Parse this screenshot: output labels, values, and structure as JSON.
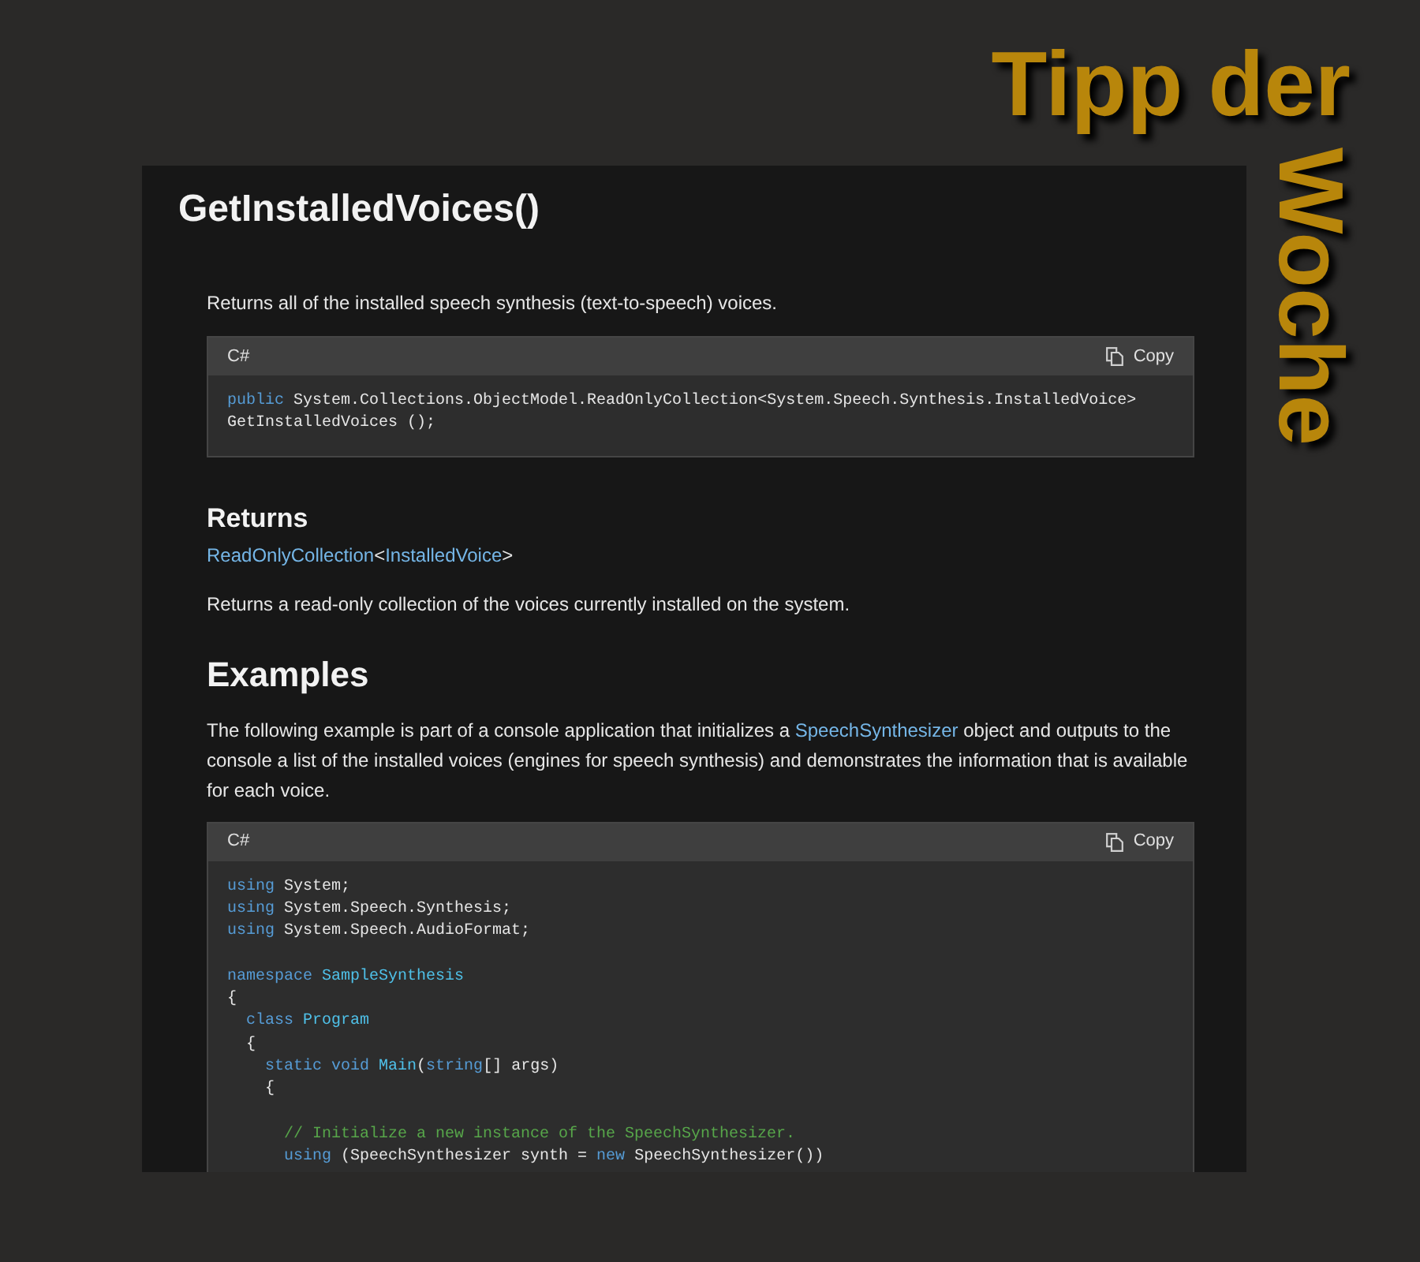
{
  "banner": {
    "line_1": "Tipp der",
    "line_2": "Woche"
  },
  "doc": {
    "title": "GetInstalledVoices()",
    "summary": "Returns all of the installed speech synthesis (text-to-speech) voices.",
    "signature": {
      "language": "C#",
      "copy_label": "Copy",
      "lines": [
        {
          "kind": "code",
          "tokens": [
            {
              "text": "public",
              "kind": "keyword"
            },
            {
              "text": " System.Collections.ObjectModel.ReadOnlyCollection<System.Speech.Synthesis.InstalledVoice>",
              "kind": "plain"
            }
          ]
        },
        {
          "kind": "code",
          "tokens": [
            {
              "text": "GetInstalledVoices ();",
              "kind": "plain"
            }
          ]
        }
      ]
    },
    "returns": {
      "heading": "Returns",
      "type_parts": [
        {
          "text": "ReadOnlyCollection",
          "kind": "link"
        },
        {
          "text": "<",
          "kind": "text"
        },
        {
          "text": "InstalledVoice",
          "kind": "link"
        },
        {
          "text": ">",
          "kind": "text"
        }
      ],
      "description": "Returns a read-only collection of the voices currently installed on the system."
    },
    "examples": {
      "heading": "Examples",
      "paragraph": [
        {
          "text": "The following example is part of a console application that initializes a ",
          "kind": "text"
        },
        {
          "text": "SpeechSynthesizer",
          "kind": "link"
        },
        {
          "text": " object and outputs to the console a list of the installed voices (engines for speech synthesis) and demonstrates the information that is available for each voice.",
          "kind": "text"
        }
      ],
      "code": {
        "language": "C#",
        "copy_label": "Copy",
        "lines": [
          {
            "kind": "code",
            "tokens": [
              {
                "text": "using",
                "kind": "keyword"
              },
              {
                "text": " System;",
                "kind": "plain"
              }
            ]
          },
          {
            "kind": "code",
            "tokens": [
              {
                "text": "using",
                "kind": "keyword"
              },
              {
                "text": " System.Speech.Synthesis;",
                "kind": "plain"
              }
            ]
          },
          {
            "kind": "code",
            "tokens": [
              {
                "text": "using",
                "kind": "keyword"
              },
              {
                "text": " System.Speech.AudioFormat;",
                "kind": "plain"
              }
            ]
          },
          {
            "kind": "blank"
          },
          {
            "kind": "code",
            "tokens": [
              {
                "text": "namespace ",
                "kind": "keyword"
              },
              {
                "text": "SampleSynthesis",
                "kind": "type"
              }
            ]
          },
          {
            "kind": "code",
            "tokens": [
              {
                "text": "{",
                "kind": "plain"
              }
            ]
          },
          {
            "kind": "code",
            "tokens": [
              {
                "text": "  class ",
                "kind": "keyword"
              },
              {
                "text": "Program",
                "kind": "type"
              }
            ]
          },
          {
            "kind": "code",
            "tokens": [
              {
                "text": "  {",
                "kind": "plain"
              }
            ]
          },
          {
            "kind": "code",
            "tokens": [
              {
                "text": "    static void ",
                "kind": "keyword"
              },
              {
                "text": "Main",
                "kind": "type"
              },
              {
                "text": "(",
                "kind": "plain"
              },
              {
                "text": "string",
                "kind": "keyword"
              },
              {
                "text": "[] args)",
                "kind": "plain"
              }
            ]
          },
          {
            "kind": "code",
            "tokens": [
              {
                "text": "    {",
                "kind": "plain"
              }
            ]
          },
          {
            "kind": "blank"
          },
          {
            "kind": "code",
            "tokens": [
              {
                "text": "      // Initialize a new instance of the SpeechSynthesizer.",
                "kind": "comment"
              }
            ]
          },
          {
            "kind": "code",
            "tokens": [
              {
                "text": "      using",
                "kind": "keyword"
              },
              {
                "text": " (SpeechSynthesizer synth = ",
                "kind": "plain"
              },
              {
                "text": "new",
                "kind": "keyword"
              },
              {
                "text": " SpeechSynthesizer())",
                "kind": "plain"
              }
            ]
          }
        ]
      }
    }
  }
}
